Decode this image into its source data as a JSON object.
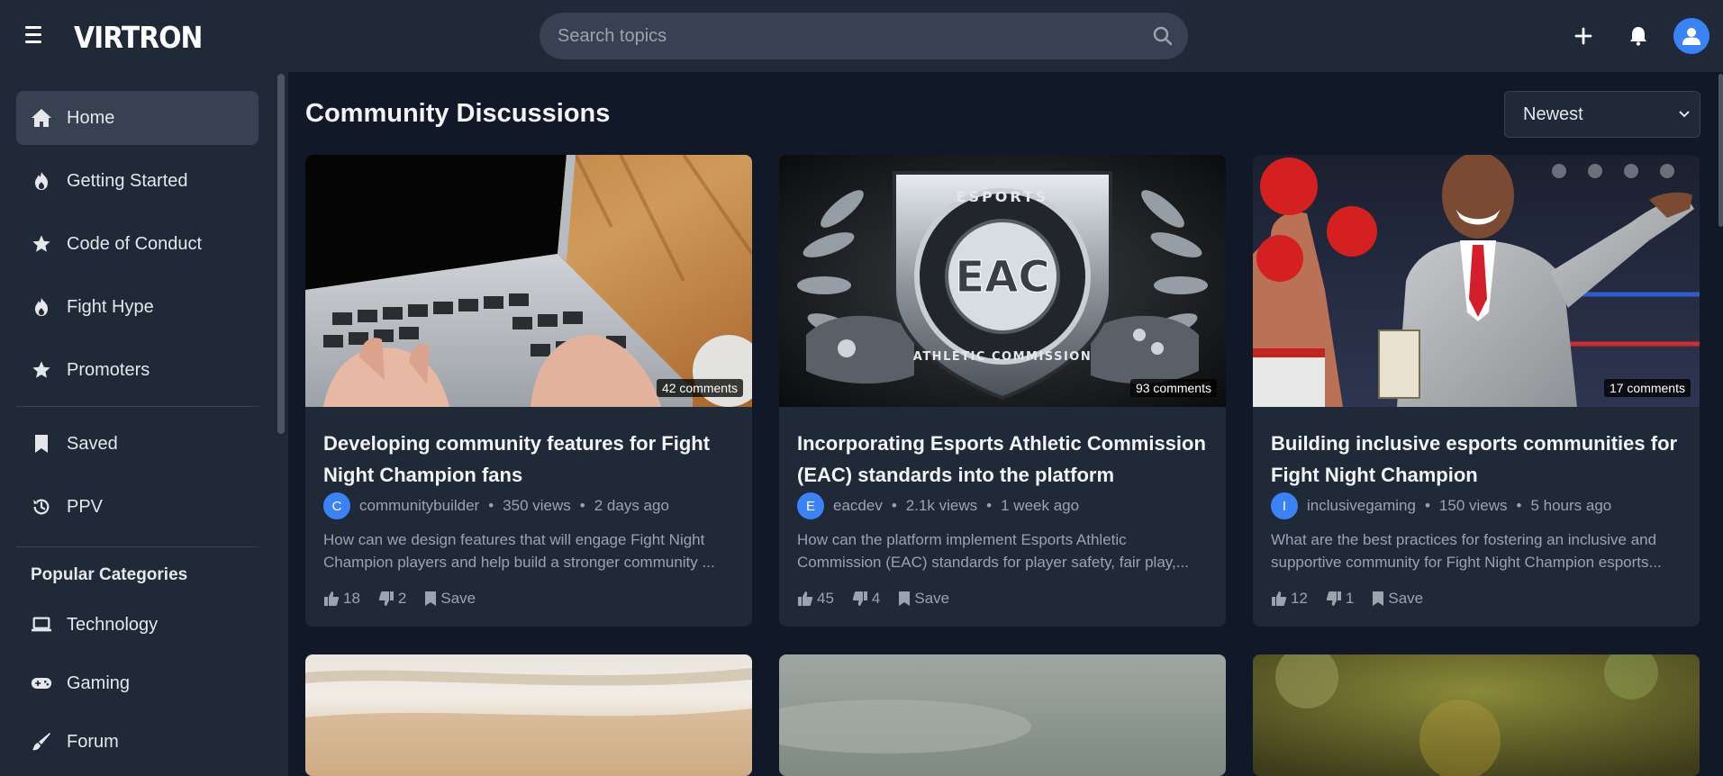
{
  "app": {
    "logo": "VIRTRON"
  },
  "search": {
    "placeholder": "Search topics"
  },
  "sidebar": {
    "items": [
      {
        "label": "Home",
        "icon": "home-icon"
      },
      {
        "label": "Getting Started",
        "icon": "flame-icon"
      },
      {
        "label": "Code of Conduct",
        "icon": "star-icon"
      },
      {
        "label": "Fight Hype",
        "icon": "flame-icon"
      },
      {
        "label": "Promoters",
        "icon": "star-icon"
      }
    ],
    "secondary": [
      {
        "label": "Saved",
        "icon": "bookmark-icon"
      },
      {
        "label": "PPV",
        "icon": "history-icon"
      }
    ],
    "categories_heading": "Popular Categories",
    "categories": [
      {
        "label": "Technology",
        "icon": "laptop-icon"
      },
      {
        "label": "Gaming",
        "icon": "gamepad-icon"
      },
      {
        "label": "Forum",
        "icon": "brush-icon"
      }
    ]
  },
  "main": {
    "title": "Community Discussions",
    "sort": "Newest",
    "save_label": "Save",
    "cards": [
      {
        "comments": "42 comments",
        "title": "Developing community features for Fight Night Champion fans",
        "avatar": "C",
        "author": "communitybuilder",
        "views": "350 views",
        "time": "2 days ago",
        "desc": "How can we design features that will engage Fight Night Champion players and help build a stronger community ...",
        "likes": "18",
        "dislikes": "2"
      },
      {
        "comments": "93 comments",
        "title": "Incorporating Esports Athletic Commission (EAC) standards into the platform",
        "avatar": "E",
        "author": "eacdev",
        "views": "2.1k views",
        "time": "1 week ago",
        "desc": "How can the platform implement Esports Athletic Commission (EAC) standards for player safety, fair play,...",
        "likes": "45",
        "dislikes": "4"
      },
      {
        "comments": "17 comments",
        "title": "Building inclusive esports communities for Fight Night Champion",
        "avatar": "I",
        "author": "inclusivegaming",
        "views": "150 views",
        "time": "5 hours ago",
        "desc": "What are the best practices for fostering an inclusive and supportive community for Fight Night Champion esports...",
        "likes": "12",
        "dislikes": "1"
      }
    ]
  },
  "colors": {
    "accent": "#3b82f6",
    "background": "#111827",
    "panel": "#1f2937"
  }
}
